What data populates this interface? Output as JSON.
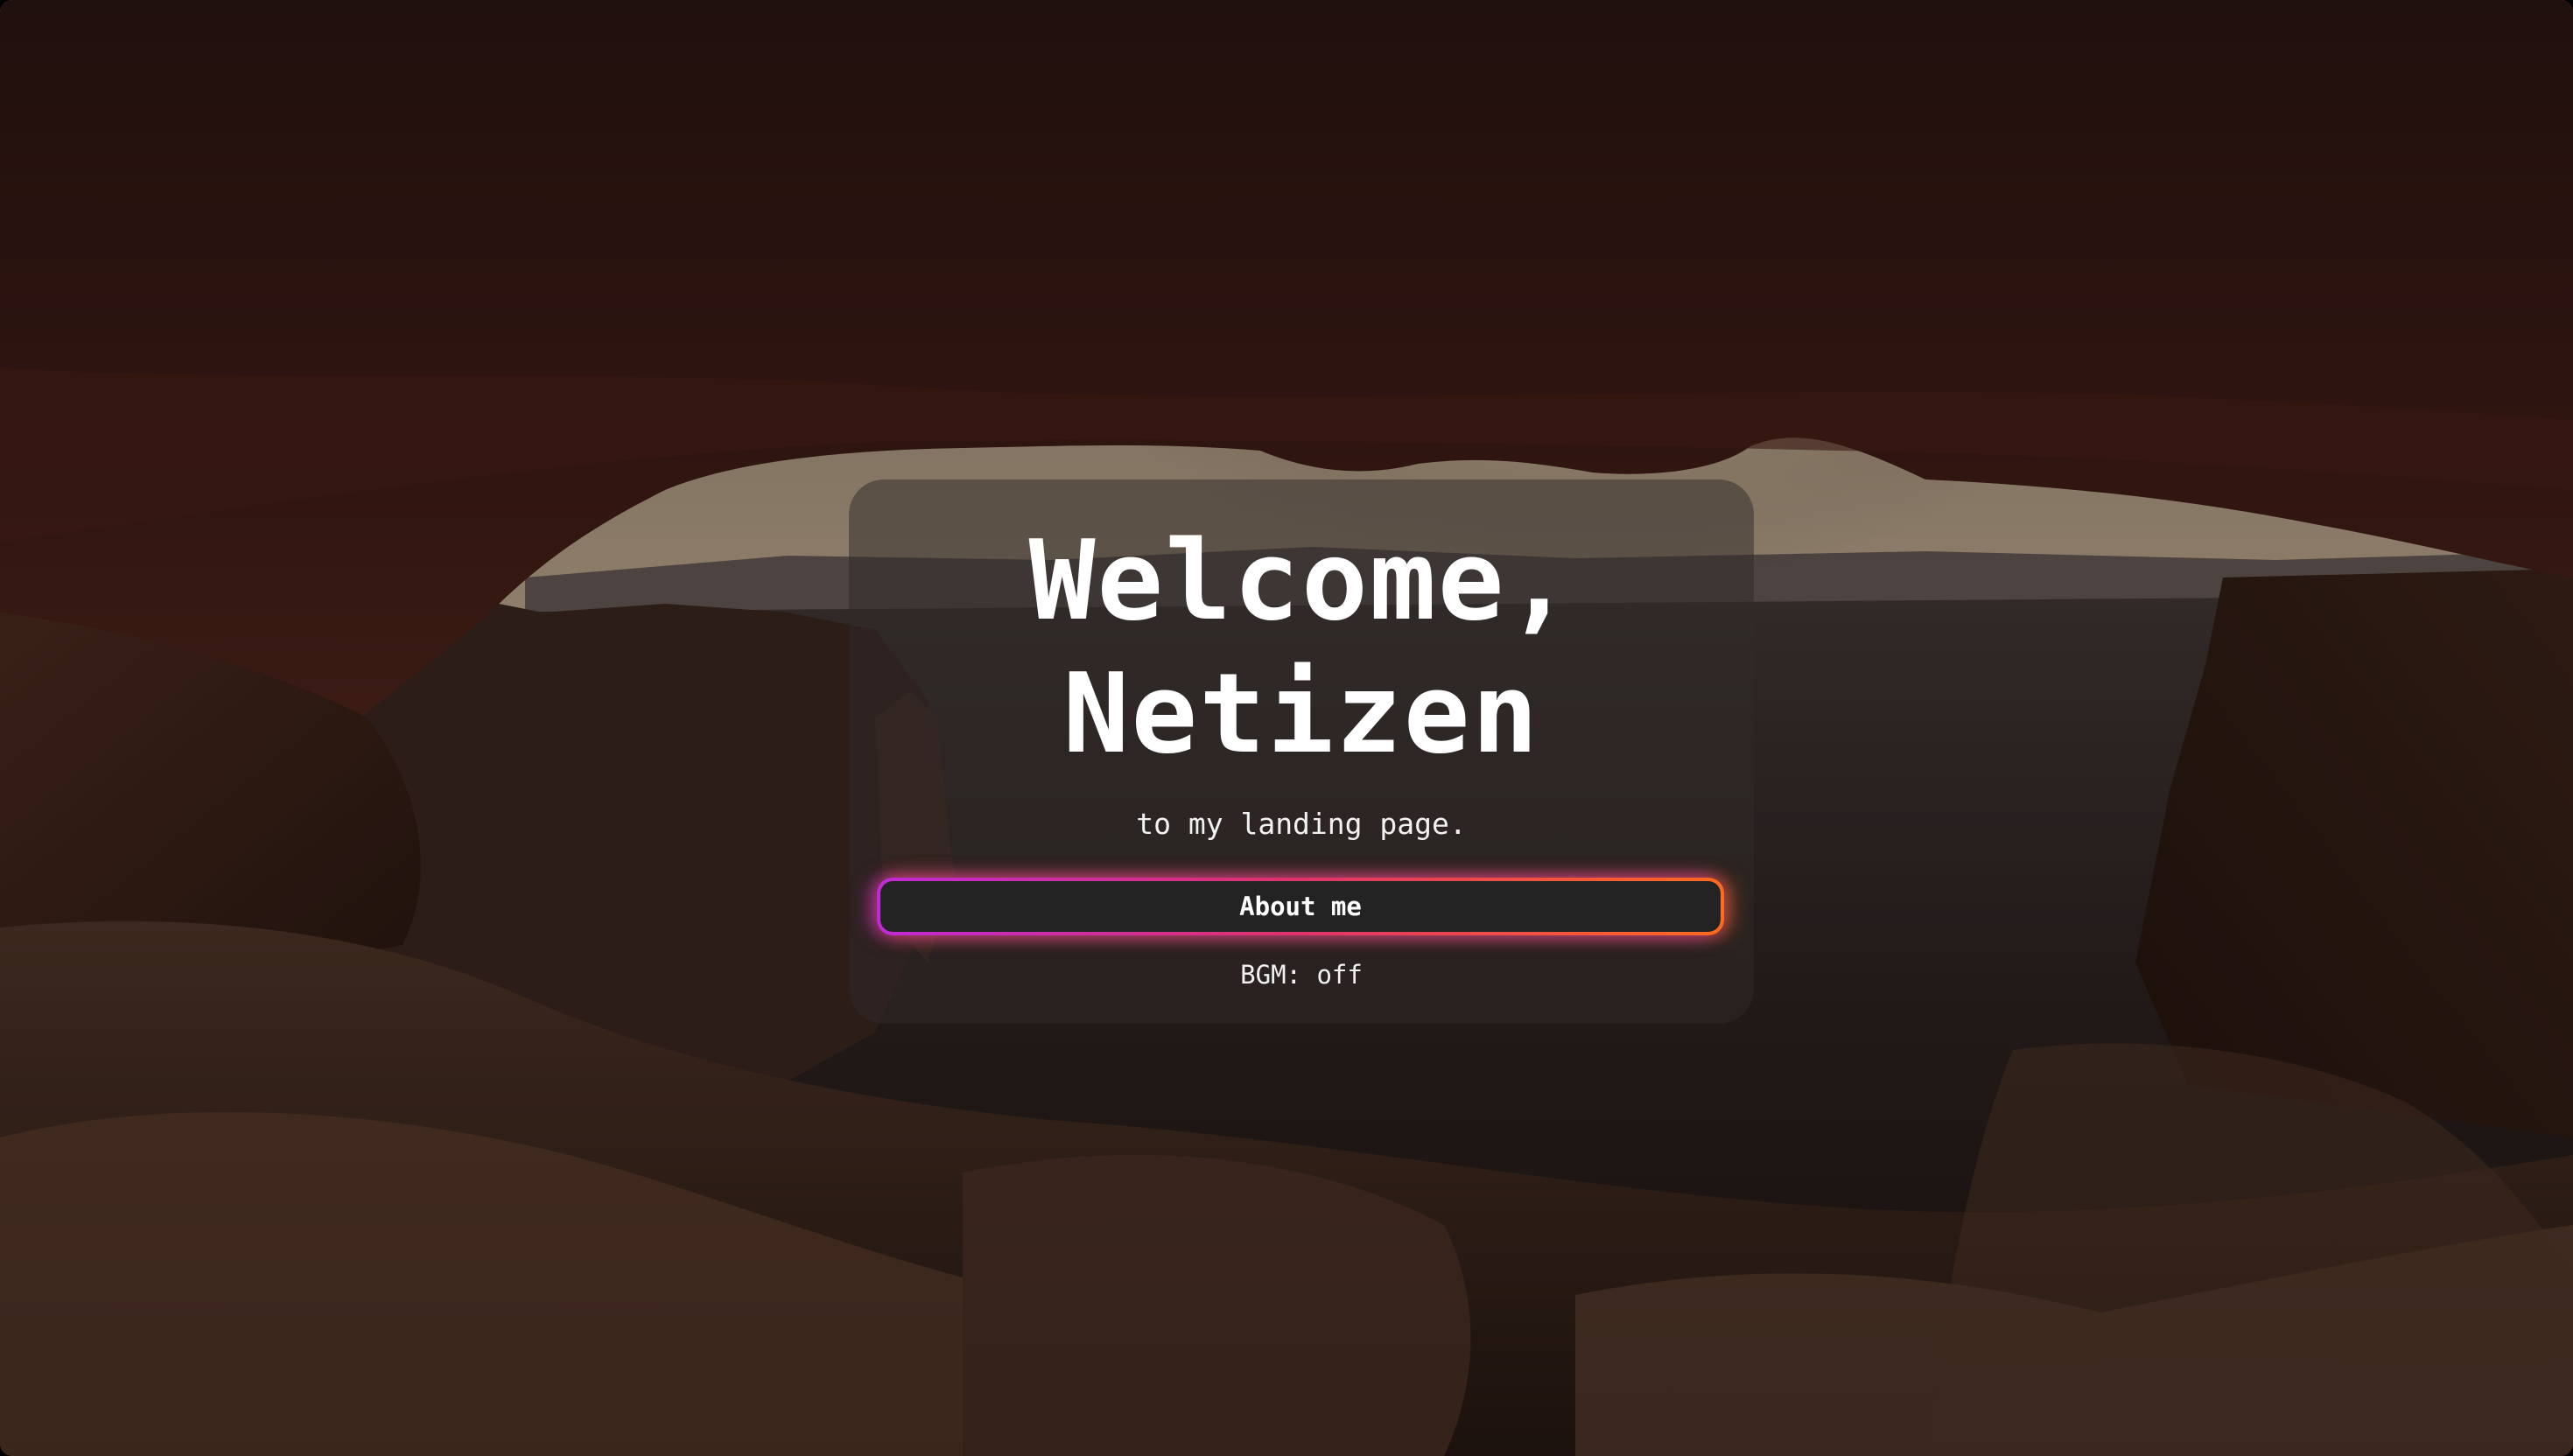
{
  "hero": {
    "title_line1": "Welcome,",
    "title_line2": "Netizen",
    "subtitle": "to my landing page."
  },
  "actions": {
    "about_label": "About me",
    "bgm_label": "BGM: off"
  },
  "colors": {
    "card_bg": "rgba(48,42,40,0.5)",
    "button_bg": "#232323",
    "gradient_start": "#c02ad6",
    "gradient_mid": "#e0336a",
    "gradient_end": "#ff6a1f",
    "text": "#ffffff"
  },
  "background": {
    "scene": "canyon-arch-sunrise-photo"
  }
}
